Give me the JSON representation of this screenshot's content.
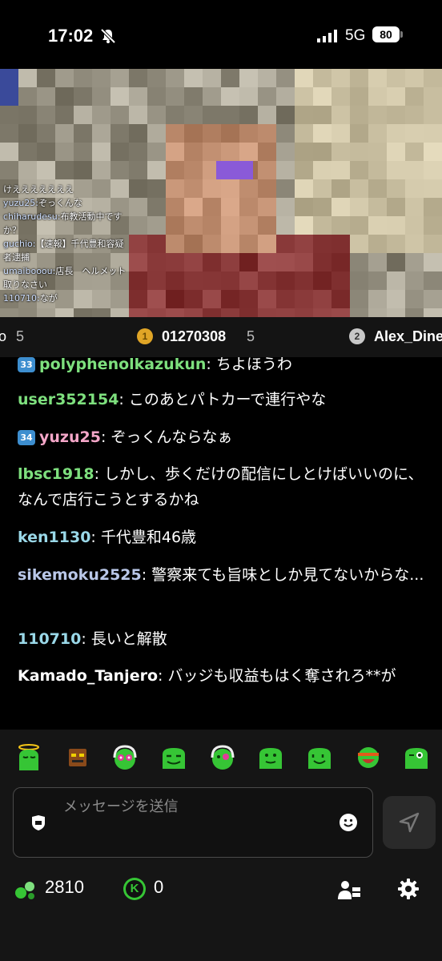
{
  "status_bar": {
    "time": "17:02",
    "network": "5G",
    "battery": "80"
  },
  "video_overlay": {
    "lines": [
      {
        "name": "",
        "text": "けえええええええ"
      },
      {
        "name": "yuzu25:",
        "text": "ぞっくんな"
      },
      {
        "name": "chiharudesu:",
        "text": "布教活動中ですか？"
      },
      {
        "name": "guchio:",
        "text": "【速報】千代豊和容疑者逮捕"
      },
      {
        "name": "umaibooou:",
        "text": "店長　ヘルメット取りなさい"
      },
      {
        "name": "110710:",
        "text": "なが"
      }
    ]
  },
  "ranking": {
    "left_fragment": "o",
    "left_count": "5",
    "first_rank": "1",
    "first_name": "01270308",
    "first_count": "5",
    "second_rank": "2",
    "second_name": "Alex_Dine"
  },
  "chat": {
    "messages": [
      {
        "badge": "33",
        "user": "polyphenolkazukun",
        "text": "ちよほうわ",
        "color": "#7ee07e"
      },
      {
        "badge": "",
        "user": "user352154",
        "text": "このあとパトカーで連行やな",
        "color": "#7ee07e"
      },
      {
        "badge": "34",
        "user": "yuzu25",
        "text": "ぞっくんならなぁ",
        "color": "#f4a6c8"
      },
      {
        "badge": "",
        "user": "lbsc1918",
        "text": "しかし、歩くだけの配信にしとけばいいのに、なんで店行こうとするかね",
        "color": "#7ee07e"
      },
      {
        "badge": "",
        "user": "ken1130",
        "text": "千代豊和46歳",
        "color": "#9ad8e8"
      },
      {
        "badge": "",
        "user": "sikemoku2525",
        "text": "警察来ても旨味としか見てないからな...",
        "color": "#b9c7e8"
      },
      {
        "badge": "",
        "user": "110710",
        "text": "長いと解散",
        "color": "#9ad8e8"
      },
      {
        "badge": "",
        "user": "Kamado_Tanjero",
        "text": "バッジも収益もはく奪されろ**が",
        "color": "#ffffff"
      }
    ]
  },
  "input": {
    "placeholder": "メッセージを送信"
  },
  "footer": {
    "points": "2810",
    "k_coins": "0",
    "k_letter": "K"
  },
  "colors": {
    "accent_green": "#2ecc40",
    "chat_bg": "#000000",
    "panel_bg": "#151515"
  },
  "icons": [
    "bell-slash-icon",
    "signal-icon",
    "emote-icon",
    "smiley-icon",
    "send-icon",
    "points-icon",
    "k-coin-icon",
    "people-icon",
    "gear-icon"
  ]
}
